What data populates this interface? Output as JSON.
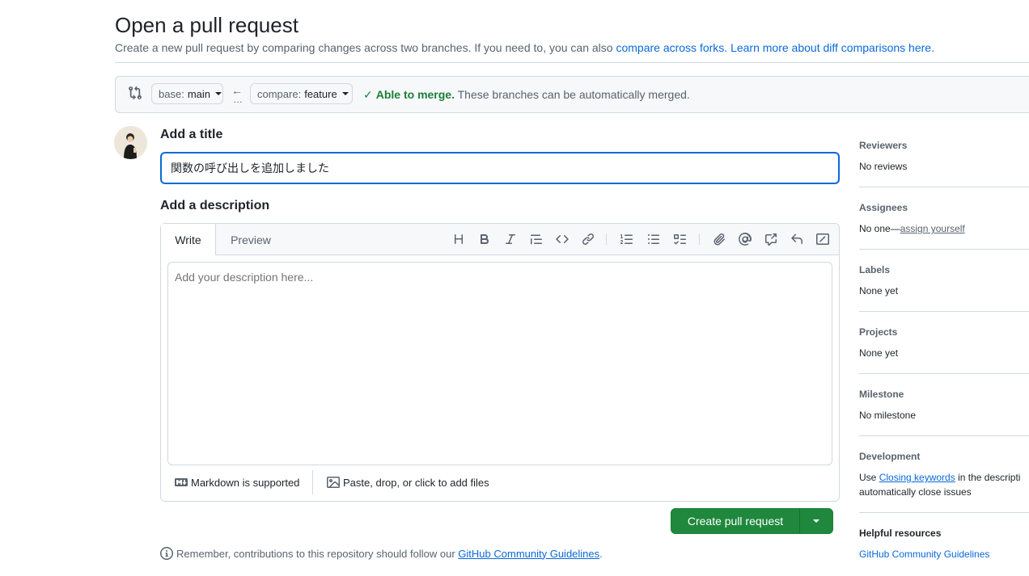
{
  "header": {
    "title": "Open a pull request",
    "subtitle_text": "Create a new pull request by comparing changes across two branches. If you need to, you can also",
    "compare_forks_link": "compare across forks.",
    "learn_more_link": "Learn more about diff comparisons here."
  },
  "range": {
    "base_prefix": "base:",
    "base_ref": "main",
    "arrow": "←",
    "dots": "…",
    "compare_prefix": "compare:",
    "compare_ref": "feature",
    "merge_ok": "Able to merge.",
    "merge_detail": "These branches can be automatically merged."
  },
  "form": {
    "title_label": "Add a title",
    "title_value": "関数の呼び出しを追加しました",
    "description_label": "Add a description",
    "tab_write": "Write",
    "tab_preview": "Preview",
    "description_placeholder": "Add your description here...",
    "markdown_note": "Markdown is supported",
    "attach_note": "Paste, drop, or click to add files",
    "submit_label": "Create pull request",
    "guidelines_prefix": "Remember, contributions to this repository should follow our",
    "guidelines_link": "GitHub Community Guidelines",
    "guidelines_suffix": "."
  },
  "toolbar_icons": [
    "heading-icon",
    "bold-icon",
    "italic-icon",
    "quote-icon",
    "code-icon",
    "link-icon",
    "ordered-list-icon",
    "unordered-list-icon",
    "task-list-icon",
    "attachment-icon",
    "mention-icon",
    "cross-reference-icon",
    "saved-reply-icon",
    "slash-command-icon"
  ],
  "sidebar": {
    "reviewers": {
      "label": "Reviewers",
      "value": "No reviews"
    },
    "assignees": {
      "label": "Assignees",
      "value_prefix": "No one—",
      "link": "assign yourself"
    },
    "labels": {
      "label": "Labels",
      "value": "None yet"
    },
    "projects": {
      "label": "Projects",
      "value": "None yet"
    },
    "milestone": {
      "label": "Milestone",
      "value": "No milestone"
    },
    "development": {
      "label": "Development",
      "line1_prefix": "Use",
      "line1_link": "Closing keywords",
      "line1_suffix": "in the descripti",
      "line2": "automatically close issues"
    },
    "helpful": {
      "label": "Helpful resources",
      "link": "GitHub Community Guidelines"
    }
  },
  "colors": {
    "accent": "#0969da",
    "success": "#1f883d",
    "border": "#d1d9e0"
  }
}
